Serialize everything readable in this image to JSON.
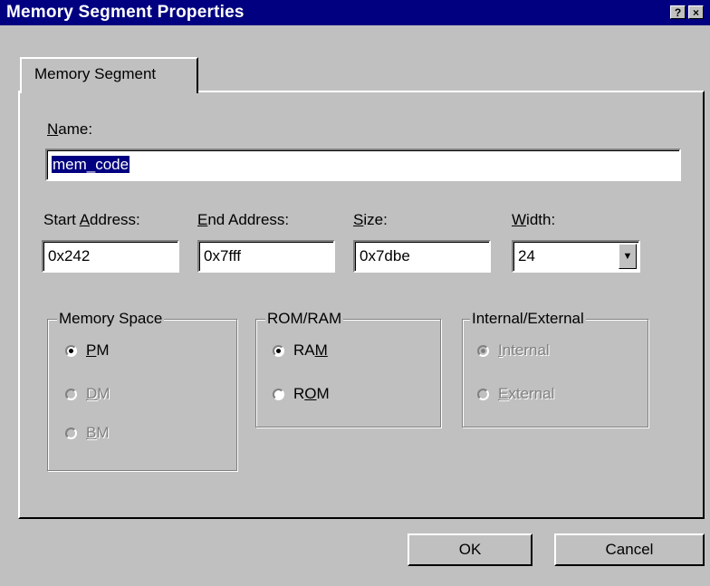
{
  "window": {
    "title": "Memory Segment Properties",
    "help_btn": "?",
    "close_btn": "×"
  },
  "tab": {
    "label": "Memory Segment"
  },
  "name": {
    "label_key": "N",
    "label_rest": "ame:",
    "value": "mem_code"
  },
  "start": {
    "label_pre": "Start ",
    "label_key": "A",
    "label_rest": "ddress:",
    "value": "0x242"
  },
  "end": {
    "label_key": "E",
    "label_rest": "nd Address:",
    "value": "0x7fff"
  },
  "size": {
    "label_key": "S",
    "label_rest": "ize:",
    "value": "0x7dbe"
  },
  "width": {
    "label_key": "W",
    "label_rest": "idth:",
    "value": "24",
    "dropdown_icon": "arrow-down-icon"
  },
  "memory_space": {
    "title": "Memory Space",
    "options": [
      {
        "pre": "",
        "key": "P",
        "rest": "M",
        "checked": true,
        "enabled": true
      },
      {
        "pre": "",
        "key": "D",
        "rest": "M",
        "checked": false,
        "enabled": false
      },
      {
        "pre": "",
        "key": "B",
        "rest": "M",
        "checked": false,
        "enabled": false
      }
    ]
  },
  "rom_ram": {
    "title": "ROM/RAM",
    "options": [
      {
        "pre": "RA",
        "key": "M",
        "rest": "",
        "checked": true,
        "enabled": true
      },
      {
        "pre": "R",
        "key": "O",
        "rest": "M",
        "checked": false,
        "enabled": true
      }
    ]
  },
  "int_ext": {
    "title": "Internal/External",
    "options": [
      {
        "pre": "",
        "key": "I",
        "rest": "nternal",
        "checked": true,
        "enabled": false
      },
      {
        "pre": "",
        "key": "E",
        "rest": "xternal",
        "checked": false,
        "enabled": false
      }
    ]
  },
  "buttons": {
    "ok": "OK",
    "cancel": "Cancel"
  }
}
